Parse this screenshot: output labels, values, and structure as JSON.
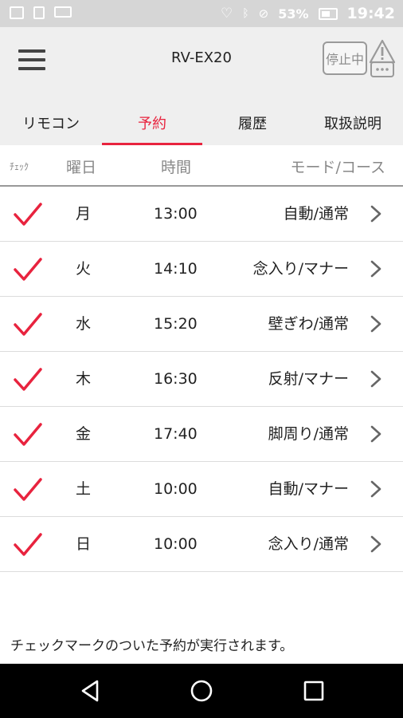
{
  "status_bar": {
    "battery_percent": "53%",
    "time": "19:42",
    "icons": [
      "image-icon",
      "download-icon",
      "voicemail-icon",
      "headset-icon",
      "bluetooth-icon",
      "no-sim-icon",
      "battery-icon"
    ]
  },
  "header": {
    "title": "RV-EX20",
    "status_chip": "停止中",
    "menu_icon": "hamburger-menu-icon",
    "warning_icon": "warning-icon"
  },
  "tabs": [
    {
      "label": "リモコン",
      "active": false
    },
    {
      "label": "予約",
      "active": true
    },
    {
      "label": "履歴",
      "active": false
    },
    {
      "label": "取扱説明",
      "active": false
    }
  ],
  "columns": {
    "check": "ﾁｪｯｸ",
    "day": "曜日",
    "time": "時間",
    "mode": "モード/コース"
  },
  "schedules": [
    {
      "checked": true,
      "day": "月",
      "time": "13:00",
      "mode": "自動/通常"
    },
    {
      "checked": true,
      "day": "火",
      "time": "14:10",
      "mode": "念入り/マナー"
    },
    {
      "checked": true,
      "day": "水",
      "time": "15:20",
      "mode": "壁ぎわ/通常"
    },
    {
      "checked": true,
      "day": "木",
      "time": "16:30",
      "mode": "反射/マナー"
    },
    {
      "checked": true,
      "day": "金",
      "time": "17:40",
      "mode": "脚周り/通常"
    },
    {
      "checked": true,
      "day": "土",
      "time": "10:00",
      "mode": "自動/マナー"
    },
    {
      "checked": true,
      "day": "日",
      "time": "10:00",
      "mode": "念入り/通常"
    }
  ],
  "footer_note": "チェックマークのついた予約が実行されます。",
  "nav": {
    "icons": [
      "back-icon",
      "home-icon",
      "recents-icon"
    ]
  },
  "colors": {
    "accent": "#e8233e",
    "header_bg": "#efefef",
    "status_bar_bg": "#d6d6d6",
    "nav_bg": "#000000"
  }
}
